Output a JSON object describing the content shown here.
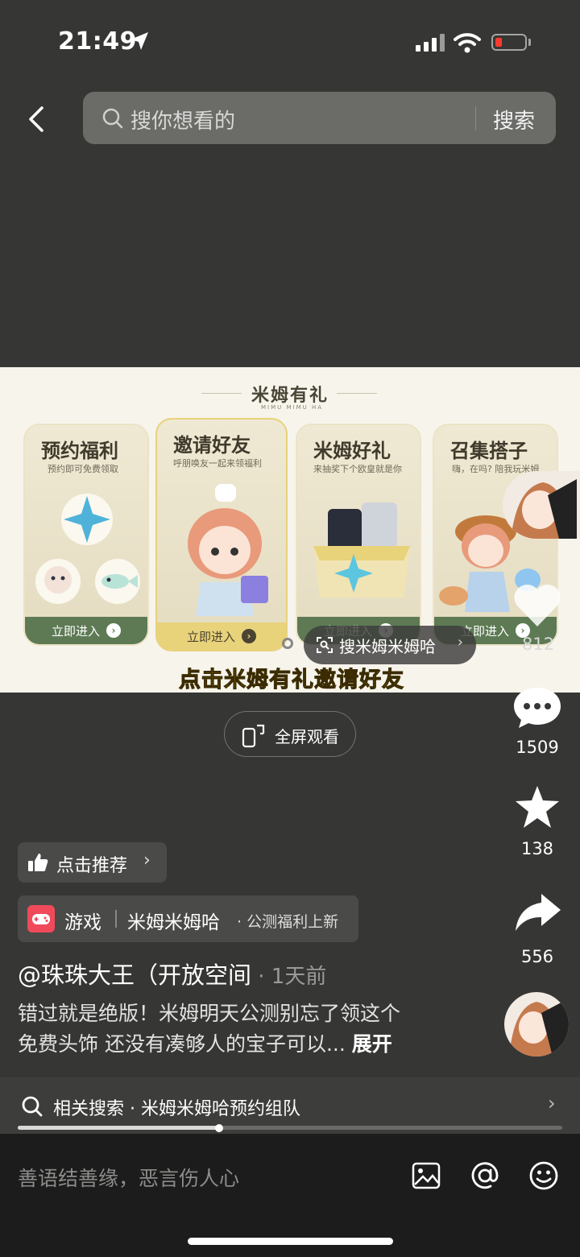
{
  "status": {
    "time": "21:49"
  },
  "search": {
    "placeholder": "搜你想看的",
    "button": "搜索"
  },
  "video": {
    "banner_title": "米姆有礼",
    "banner_subtitle": "MIMU MIMU HA",
    "cards": [
      {
        "title": "预约福利",
        "subtitle": "预约即可免费领取",
        "button": "立即进入"
      },
      {
        "title": "邀请好友",
        "subtitle": "呼朋唤友一起来领福利",
        "button": "立即进入"
      },
      {
        "title": "米姆好礼",
        "subtitle": "来抽奖下个欧皇就是你",
        "button": "立即进入"
      },
      {
        "title": "召集搭子",
        "subtitle": "嗨，在吗? 陪我玩米姆",
        "button": "立即进入"
      }
    ],
    "caption": "点击米姆有礼邀请好友",
    "search_pill": "搜米姆米姆哈"
  },
  "fullscreen_label": "全屏观看",
  "actions": {
    "likes": "812",
    "comments": "1509",
    "favorites": "138",
    "shares": "556"
  },
  "recommend_label": "点击推荐",
  "tag": {
    "category": "游戏",
    "name": "米姆米姆哈",
    "extra": "· 公测福利上新"
  },
  "author": {
    "name": "@珠珠大王（开放空间",
    "time": " · 1天前"
  },
  "description": {
    "line1": "错过就是绝版！米姆明天公测别忘了领这个",
    "line2": "免费头饰 还没有凑够人的宝子可以...",
    "expand": "展开"
  },
  "related": "相关搜索 · 米姆米姆哈预约组队",
  "progress": 0.37,
  "comment_placeholder": "善语结善缘，恶言伤人心",
  "colors": {
    "background": "#363634",
    "caption": "#e7c32a",
    "card_button": "#5d7a54"
  }
}
